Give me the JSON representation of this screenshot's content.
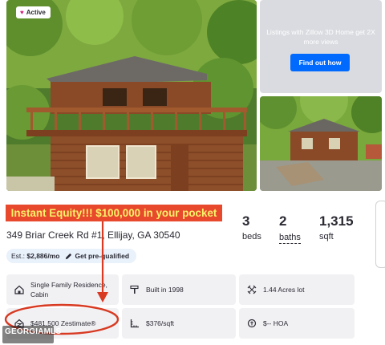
{
  "listing": {
    "status_label": "Active",
    "headline": "Instant Equity!!! $100,000 in your pocket",
    "address": "349 Briar Creek Rd #1, Ellijay, GA 30540",
    "beds_value": "3",
    "beds_label": "beds",
    "baths_value": "2",
    "baths_label": "baths",
    "sqft_value": "1,315",
    "sqft_label": "sqft"
  },
  "promo": {
    "text": "Listings with Zillow 3D Home get 2X more views",
    "button_label": "Find out how"
  },
  "estimate": {
    "prefix": "Est.:",
    "payment": "$2,886/mo",
    "prequal_label": "Get pre-qualified"
  },
  "attributes": {
    "home_type": "Single Family Residence, Cabin",
    "built": "Built in 1998",
    "lot": "1.44 Acres lot",
    "zestimate": "$481,500 Zestimate®",
    "price_per_sqft": "$376/sqft",
    "hoa": "$-- HOA"
  },
  "watermark": {
    "text": "GEORGIAMLS"
  },
  "colors": {
    "accent_blue": "#006aff",
    "banner_red": "#e8492c",
    "banner_text_yellow": "#f9f26a",
    "annotation_red": "#d83a22",
    "tile_bg": "#f1f1f4"
  }
}
